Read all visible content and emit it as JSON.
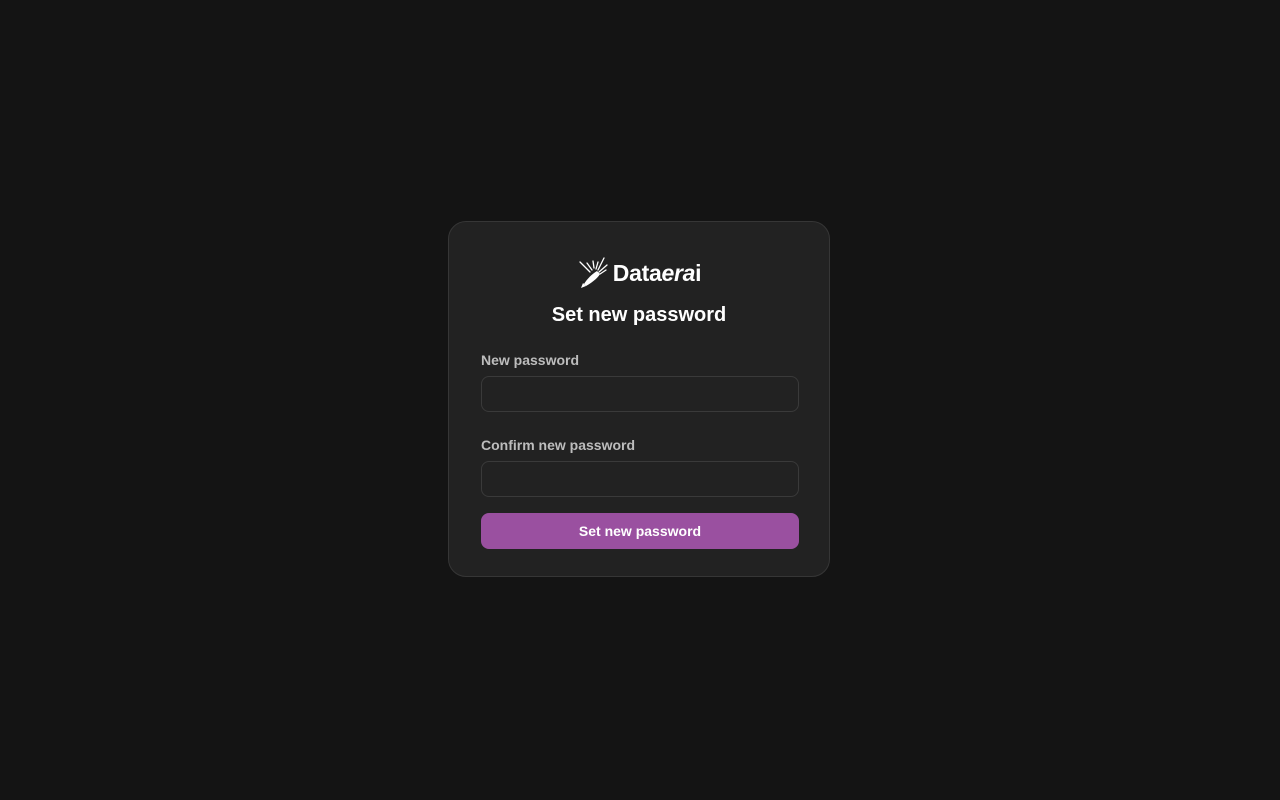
{
  "brand": {
    "name_regular": "Data",
    "name_italic": "era",
    "name_suffix": "i",
    "logo_icon": "rocket-burst-icon"
  },
  "form": {
    "title": "Set new password",
    "new_password": {
      "label": "New password",
      "value": "",
      "placeholder": ""
    },
    "confirm_password": {
      "label": "Confirm new password",
      "value": "",
      "placeholder": ""
    },
    "submit_label": "Set new password"
  },
  "colors": {
    "background": "#141414",
    "card": "#222222",
    "accent": "#9a50a0",
    "label": "#bdbdbd"
  }
}
